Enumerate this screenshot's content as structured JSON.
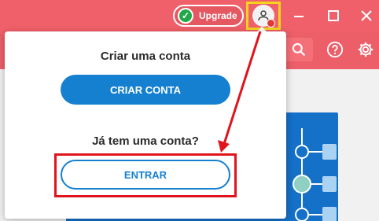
{
  "titlebar": {
    "upgrade_label": "Upgrade"
  },
  "popup": {
    "create_title": "Criar uma conta",
    "create_button": "CRIAR CONTA",
    "has_account": "Já tem uma conta?",
    "login_button": "ENTRAR"
  },
  "icons": {
    "upgrade": "check-circle-icon",
    "account": "user-icon",
    "notification": "notification-dot-icon",
    "minimize": "minimize-icon",
    "maximize": "maximize-icon",
    "close": "close-icon",
    "search": "search-icon",
    "help": "help-icon",
    "settings": "gear-icon"
  },
  "colors": {
    "header": "#f0606a",
    "primary": "#1580d0",
    "highlight_box": "#e0141c",
    "account_highlight": "#f4d41e",
    "upgrade_check": "#20a84a",
    "diagram_card": "#1570c8"
  }
}
